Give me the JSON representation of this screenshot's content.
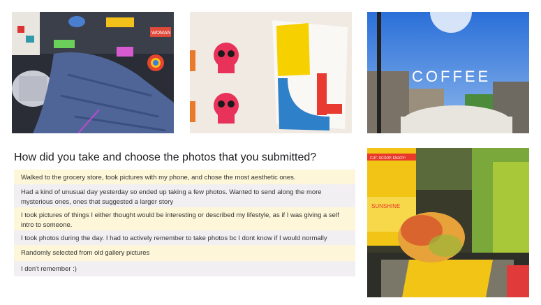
{
  "question": "How did you take and choose the photos that you submitted?",
  "answers": [
    "Walked to the grocery store, took pictures with my phone, and chose the most aesthetic ones.",
    "Had a kind of unusual day yesterday so ended up taking a few photos. Wanted to send along the more mysterious ones, ones that suggested a larger story",
    "I took pictures of things I either thought would be interesting or described my lifestyle, as if I was giving a self intro to someone.",
    "I took photos during the day. I had to actively remember to take photos bc I dont know if I would normally",
    "Randomly selected from old gallery pictures",
    "I don't remember :)"
  ],
  "photos": {
    "laptop_stickers": {
      "sticker_text": "WOMAN"
    },
    "coffee_window": {
      "window_text": "COFFEE"
    },
    "mango": {
      "box_text": "SUNSHINE",
      "label_text": "CUT. SCOOP. ENJOY!"
    }
  },
  "colors": {
    "row_yellow": "#fdf6d8",
    "row_gray": "#f1eff1",
    "skull_pink": "#e8325a"
  }
}
